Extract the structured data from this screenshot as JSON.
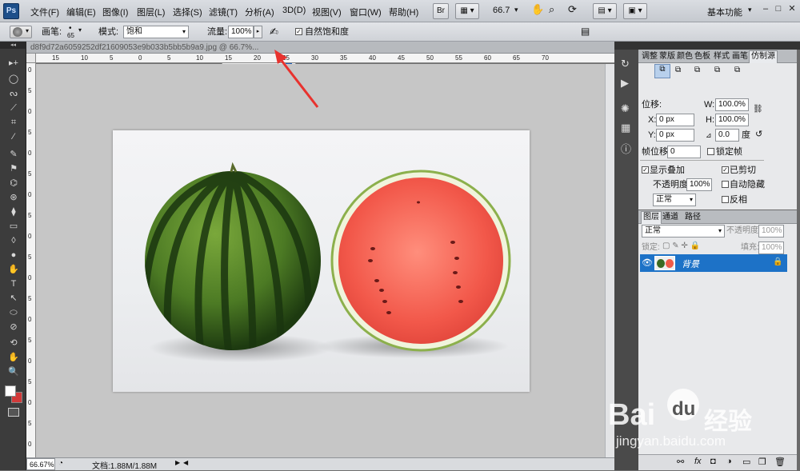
{
  "menubar": {
    "logo": "Ps",
    "items": [
      "文件(F)",
      "编辑(E)",
      "图像(I)",
      "图层(L)",
      "选择(S)",
      "滤镜(T)",
      "分析(A)",
      "3D(D)",
      "视图(V)",
      "窗口(W)",
      "帮助(H)"
    ],
    "zoom_value": "66.7",
    "workspace": "基本功能",
    "window_buttons": [
      "–",
      "□",
      "✕"
    ]
  },
  "options": {
    "brush_label": "画笔:",
    "brush_size": "65",
    "mode_label": "模式:",
    "mode_value": "饱和",
    "flow_label": "流量:",
    "flow_value": "100%",
    "vibrance_label": "自然饱和度",
    "vibrance_checked": true
  },
  "document": {
    "tab_title": "d8f9d72a6059252df21609053e9b033b5bb5b9a9.jpg @ 66.7%...",
    "ruler_ticks": [
      "15",
      "10",
      "5",
      "0",
      "5",
      "10",
      "15",
      "20",
      "25",
      "30",
      "35",
      "40",
      "45",
      "50",
      "55",
      "60",
      "65",
      "70"
    ],
    "ruler_v_ticks": [
      "0",
      "5",
      "0",
      "5",
      "0",
      "5",
      "0",
      "5",
      "0",
      "5",
      "0",
      "5",
      "0",
      "5",
      "0",
      "5",
      "0",
      "5",
      "0"
    ],
    "status_zoom": "66.67%",
    "status_doc": "文档:1.88M/1.88M"
  },
  "tools": [
    "▸+",
    "◯",
    "ᔓ",
    "⟋",
    "⌗",
    "⁄",
    "✎",
    "⚑",
    "⌬",
    "⊛",
    "⧫",
    "▭",
    "◊",
    "●",
    "✋",
    "T",
    "↖",
    "⬭",
    "⊘",
    "⟲",
    "✋",
    "🔍"
  ],
  "clone_panel": {
    "tabs": [
      "调整",
      "蒙版",
      "颜色",
      "色板",
      "样式",
      "画笔",
      "仿制源"
    ],
    "offset_label": "位移:",
    "w_label": "W:",
    "w_value": "100.0%",
    "x_label": "X:",
    "x_value": "0 px",
    "h_label": "H:",
    "h_value": "100.0%",
    "y_label": "Y:",
    "y_value": "0 px",
    "angle_value": "0.0",
    "angle_unit": "度",
    "frame_label": "帧位移:",
    "frame_value": "0",
    "lock_frame": "锁定帧",
    "show_overlay": "显示叠加",
    "clipped": "已剪切",
    "opacity_label": "不透明度:",
    "opacity_value": "100%",
    "auto_hide": "自动隐藏",
    "blend_value": "正常",
    "invert": "反相"
  },
  "layers_panel": {
    "tabs": [
      "图层",
      "通道",
      "路径"
    ],
    "blend_value": "正常",
    "opacity_label": "不透明度:",
    "opacity_value": "100%",
    "lock_label": "锁定:",
    "fill_label": "填充:",
    "fill_value": "100%",
    "layer_name": "背景"
  },
  "watermark": {
    "brand": "Bai",
    "brand2": "du",
    "cn": "经验",
    "url": "jingyan.baidu.com"
  },
  "colors": {
    "accent": "#1d72c7",
    "arrow": "#e8322e"
  }
}
